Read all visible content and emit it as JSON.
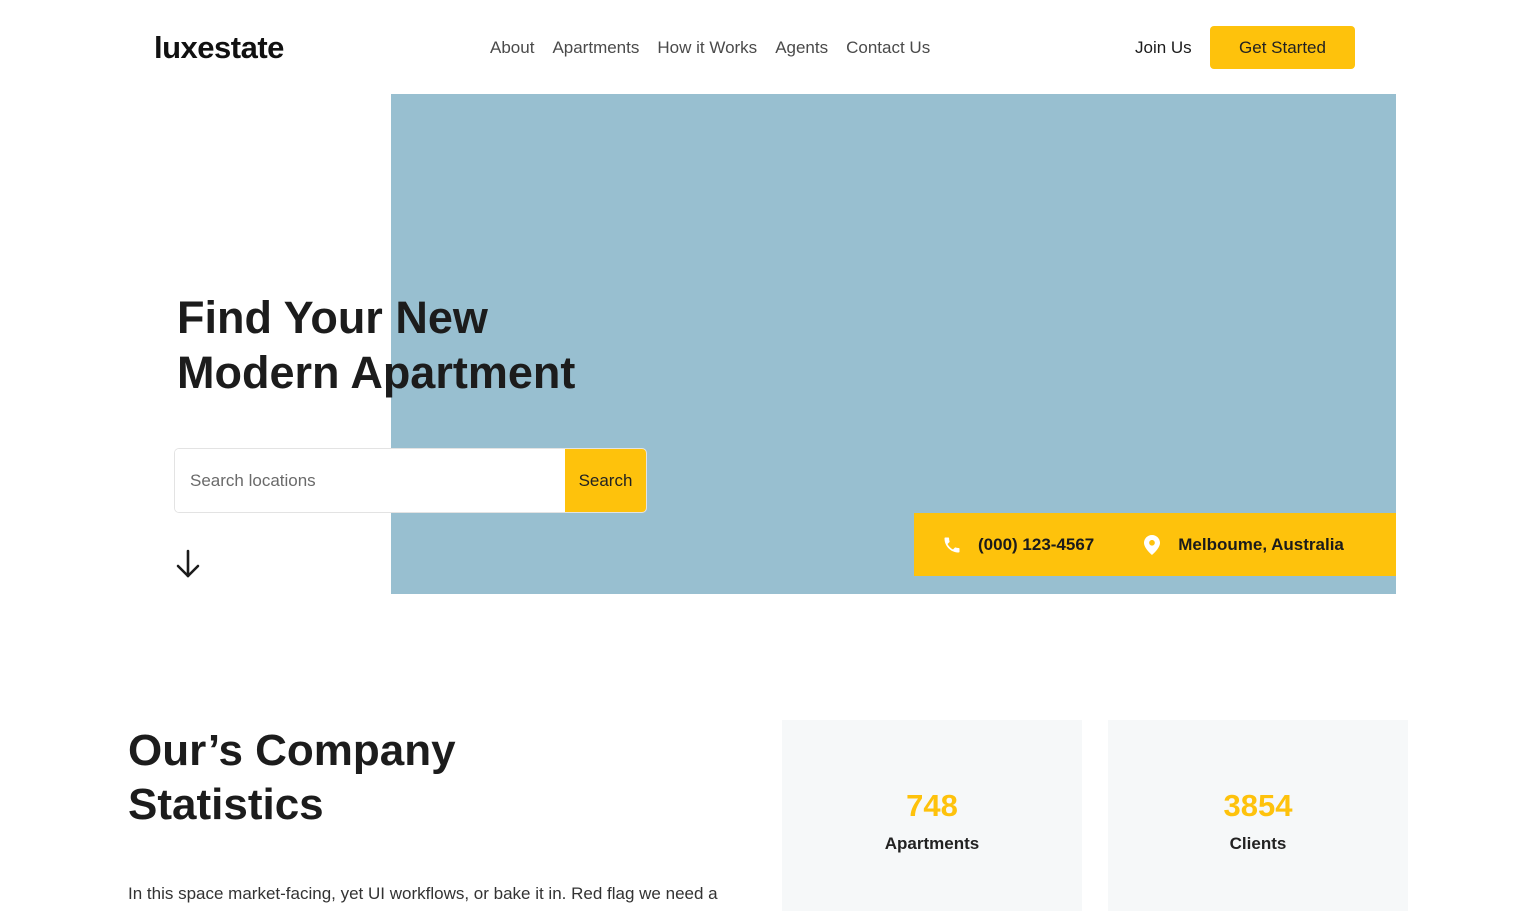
{
  "header": {
    "logo": "luxestate",
    "nav": [
      "About",
      "Apartments",
      "How it Works",
      "Agents",
      "Contact Us"
    ],
    "join_label": "Join Us",
    "cta_label": "Get Started"
  },
  "hero": {
    "title_line1": "Find Your New",
    "title_line2": "Modern Apartment",
    "search_placeholder": "Search locations",
    "search_button": "Search",
    "phone": "(000) 123-4567",
    "location": "Melboume, Australia",
    "icons": [
      "phone-icon",
      "location-pin-icon",
      "arrow-down-icon"
    ]
  },
  "stats": {
    "title_line1": "Our’s Company",
    "title_line2": "Statistics",
    "description": "In this space market-facing, yet UI workflows, or bake it in. Red flag we need a",
    "items": [
      {
        "value": "748",
        "label": "Apartments"
      },
      {
        "value": "3854",
        "label": "Clients"
      }
    ]
  },
  "colors": {
    "accent": "#fec20c",
    "hero_bg": "#98bfd0",
    "card_bg": "#f6f8f9"
  }
}
